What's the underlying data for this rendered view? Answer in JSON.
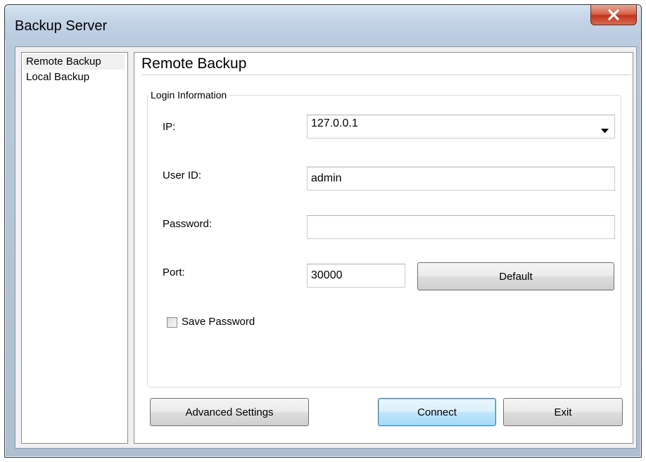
{
  "window": {
    "title": "Backup Server",
    "close_icon": "close-x-icon"
  },
  "sidebar": {
    "items": [
      {
        "label": "Remote Backup",
        "selected": true
      },
      {
        "label": "Local Backup",
        "selected": false
      }
    ]
  },
  "main": {
    "title": "Remote Backup",
    "group_title": "Login Information",
    "fields": {
      "ip": {
        "label": "IP:",
        "value": "127.0.0.1"
      },
      "user_id": {
        "label": "User ID:",
        "value": "admin"
      },
      "password": {
        "label": "Password:",
        "value": ""
      },
      "port": {
        "label": "Port:",
        "value": "30000"
      }
    },
    "default_button": "Default",
    "save_password": {
      "label": "Save Password",
      "checked": false
    }
  },
  "buttons": {
    "advanced": "Advanced Settings",
    "connect": "Connect",
    "exit": "Exit"
  },
  "colors": {
    "close_button": "#c2361d",
    "connect_border": "#3c7fb1",
    "title_bar": "#c3d4e6"
  }
}
